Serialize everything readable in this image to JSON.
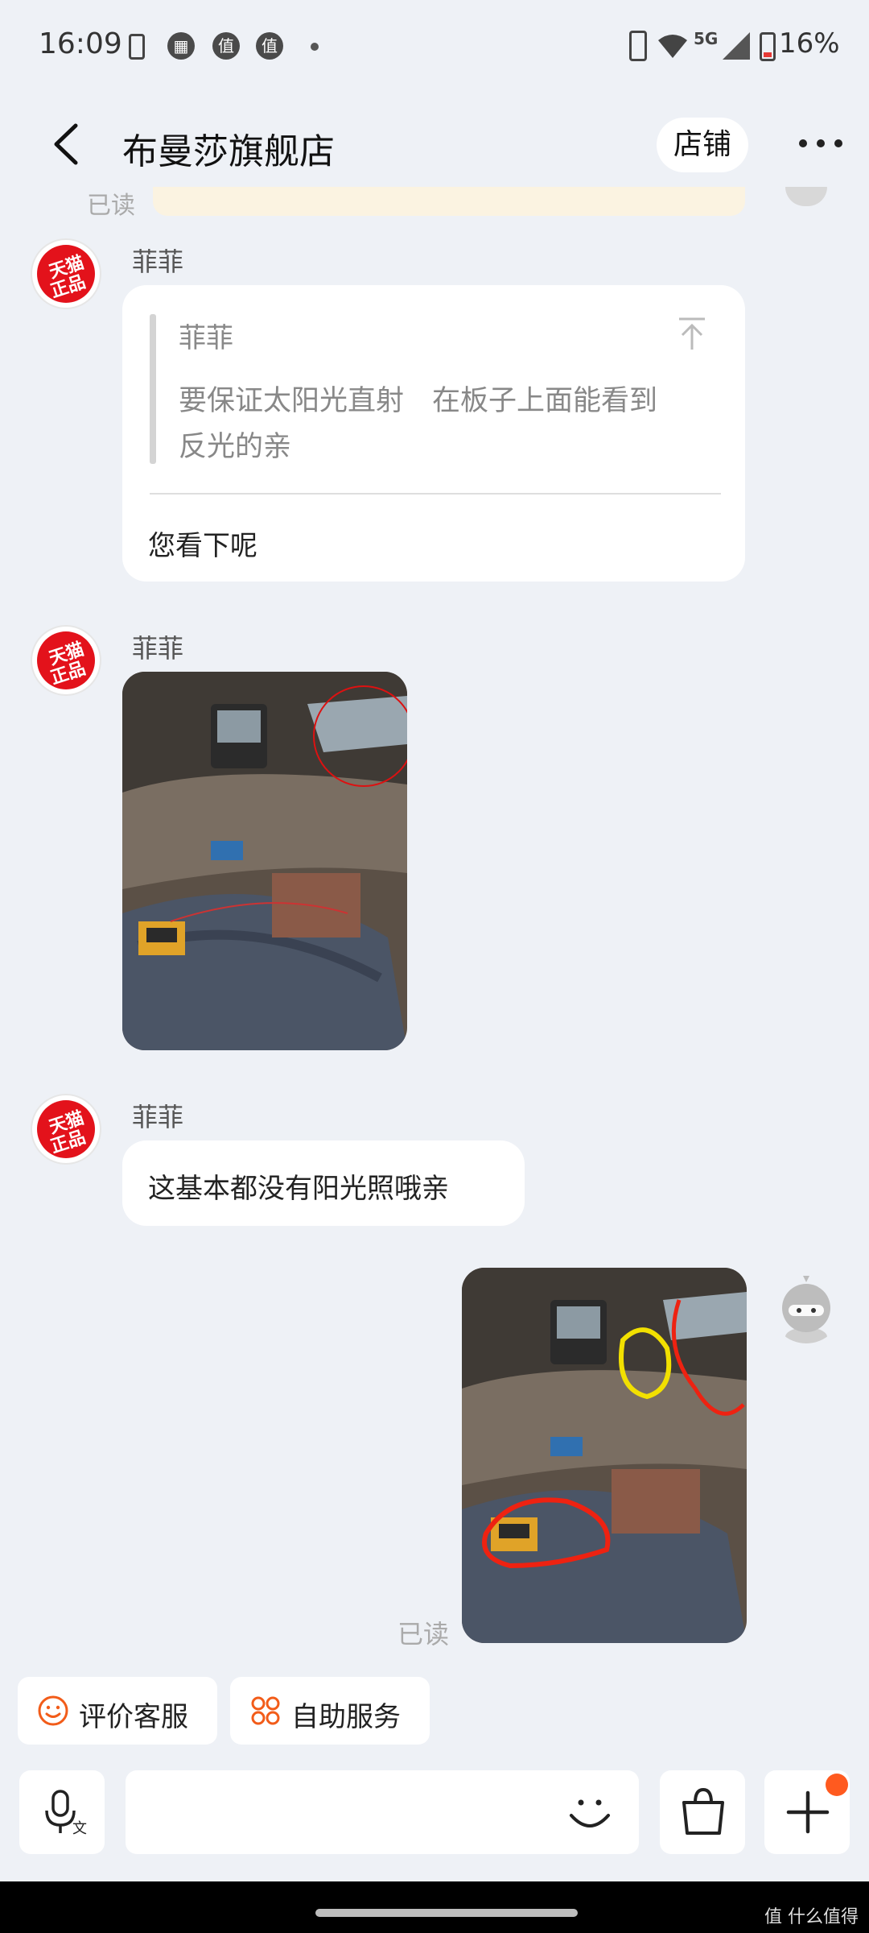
{
  "status_bar": {
    "time": "16:09",
    "icons_left": [
      "battery-saver-icon",
      "calendar-icon",
      "zhi-app-icon",
      "zhi-app-icon",
      "dot-icon"
    ],
    "network": "5G",
    "battery": "16%"
  },
  "header": {
    "title": "布曼莎旗舰店",
    "store_button": "店铺"
  },
  "top_partial": {
    "read_label": "已读"
  },
  "avatar_badge": {
    "line1": "天猫",
    "line2": "正品"
  },
  "messages": [
    {
      "sender": "菲菲",
      "quote_sender": "菲菲",
      "quote_text": "要保证太阳光直射　在板子上面能看到反光的亲",
      "text": "您看下呢"
    },
    {
      "sender": "菲菲",
      "type": "image"
    },
    {
      "sender": "菲菲",
      "text": "这基本都没有阳光照哦亲"
    },
    {
      "type": "image",
      "from": "me",
      "read_label": "已读"
    }
  ],
  "quick_actions": [
    {
      "label": "评价客服",
      "icon": "smile-icon"
    },
    {
      "label": "自助服务",
      "icon": "grid-icon"
    }
  ],
  "input_bar": {
    "voice_icon": "voice-input-icon",
    "emoji_icon": "emoji-icon",
    "bag_icon": "shopping-bag-icon",
    "plus_icon": "plus-icon"
  },
  "watermark": "值 什么值得买",
  "colors": {
    "accent": "#f25c19",
    "badge_red": "#e3121b",
    "notify_dot": "#ff5a1f"
  }
}
